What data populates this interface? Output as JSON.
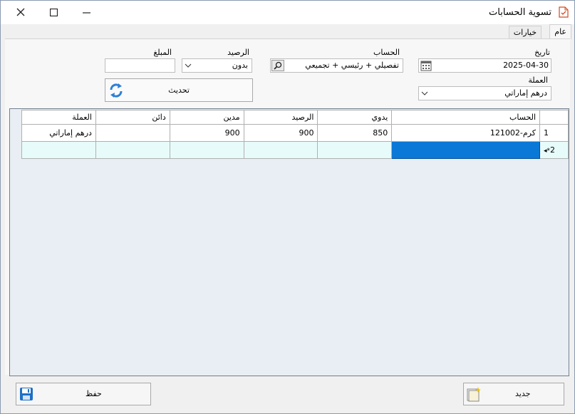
{
  "window": {
    "title": "تسوية الحسابات"
  },
  "tabs": [
    {
      "label": "عام"
    },
    {
      "label": "خيارات"
    }
  ],
  "form": {
    "date_label": "تاريخ",
    "date_value": "2025-04-30",
    "account_label": "الحساب",
    "account_value": "تفصيلي + رئيسي + تجميعي",
    "balance_label": "الرصيد",
    "balance_value": "بدون",
    "amount_label": "المبلغ",
    "amount_value": "",
    "currency_label": "العملة",
    "currency_value": "درهم إماراتي",
    "refresh_label": "تحديث"
  },
  "grid": {
    "columns": [
      "الحساب",
      "يدوي",
      "الرصيد",
      "مدين",
      "دائن",
      "العملة"
    ],
    "rows": [
      {
        "num": "1",
        "account": "121002-كرم",
        "manual": "850",
        "balance": "900",
        "debit": "900",
        "credit": "",
        "currency": "درهم إماراتي"
      }
    ],
    "new_row": {
      "num": "2",
      "marker": "◂*"
    }
  },
  "buttons": {
    "save": "حفظ",
    "new": "جديد"
  },
  "colors": {
    "selection": "#0a78d7",
    "new_row": "#e8fbfb",
    "grid_bg": "#e8eef3"
  }
}
